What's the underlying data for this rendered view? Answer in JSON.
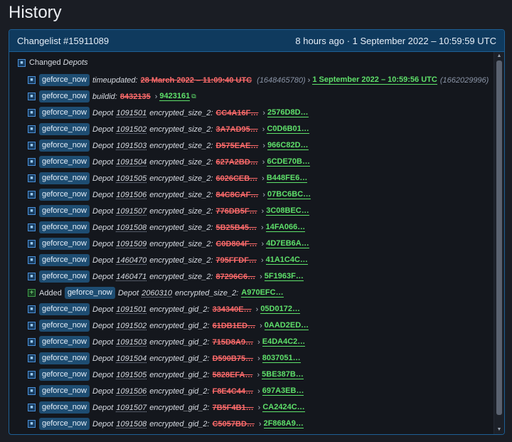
{
  "page": {
    "title": "History"
  },
  "changelist": {
    "title": "Changelist #15911089",
    "meta": "8 hours ago · 1 September 2022 – 10:59:59 UTC"
  },
  "section": {
    "label": "Changed",
    "label_italic": "Depots"
  },
  "app_tag": "geforce_now",
  "rows": [
    {
      "kind": "changed",
      "pre": "timeupdated:",
      "depot": "",
      "key": "",
      "old": "28 March 2022 – 11:09:40 UTC",
      "old_extra": "(1648465780)",
      "new": "1 September 2022 – 10:59:56 UTC",
      "new_extra": "(1662029996)"
    },
    {
      "kind": "changed",
      "pre": "buildid:",
      "depot": "",
      "key": "",
      "old": "8432135",
      "old_extra": "",
      "new": "9423161",
      "new_extra": ""
    },
    {
      "kind": "changed",
      "pre": "Depot",
      "depot": "1091501",
      "key": "encrypted_size_2:",
      "old": "CC4A16F…",
      "new": "2576D8D…"
    },
    {
      "kind": "changed",
      "pre": "Depot",
      "depot": "1091502",
      "key": "encrypted_size_2:",
      "old": "3A7AD95…",
      "new": "C0D6B01…"
    },
    {
      "kind": "changed",
      "pre": "Depot",
      "depot": "1091503",
      "key": "encrypted_size_2:",
      "old": "D575EAE…",
      "new": "966C82D…"
    },
    {
      "kind": "changed",
      "pre": "Depot",
      "depot": "1091504",
      "key": "encrypted_size_2:",
      "old": "627A2BD…",
      "new": "6CDE70B…"
    },
    {
      "kind": "changed",
      "pre": "Depot",
      "depot": "1091505",
      "key": "encrypted_size_2:",
      "old": "6026CEB…",
      "new": "B448FE6…"
    },
    {
      "kind": "changed",
      "pre": "Depot",
      "depot": "1091506",
      "key": "encrypted_size_2:",
      "old": "84C8CAF…",
      "new": "07BC6BC…"
    },
    {
      "kind": "changed",
      "pre": "Depot",
      "depot": "1091507",
      "key": "encrypted_size_2:",
      "old": "776DB5F…",
      "new": "3C08BEC…"
    },
    {
      "kind": "changed",
      "pre": "Depot",
      "depot": "1091508",
      "key": "encrypted_size_2:",
      "old": "5B25B45…",
      "new": "14FA066…"
    },
    {
      "kind": "changed",
      "pre": "Depot",
      "depot": "1091509",
      "key": "encrypted_size_2:",
      "old": "C0D804F…",
      "new": "4D7EB6A…"
    },
    {
      "kind": "changed",
      "pre": "Depot",
      "depot": "1460470",
      "key": "encrypted_size_2:",
      "old": "795FFDF…",
      "new": "41A1C4C…"
    },
    {
      "kind": "changed",
      "pre": "Depot",
      "depot": "1460471",
      "key": "encrypted_size_2:",
      "old": "87296C6…",
      "new": "5F1963F…"
    },
    {
      "kind": "added",
      "label": "Added",
      "pre": "Depot",
      "depot": "2060310",
      "key": "encrypted_size_2:",
      "new": "A970EFC…"
    },
    {
      "kind": "changed",
      "pre": "Depot",
      "depot": "1091501",
      "key": "encrypted_gid_2:",
      "old": "334340E…",
      "new": "05D0172…"
    },
    {
      "kind": "changed",
      "pre": "Depot",
      "depot": "1091502",
      "key": "encrypted_gid_2:",
      "old": "61DB1ED…",
      "new": "0AAD2ED…"
    },
    {
      "kind": "changed",
      "pre": "Depot",
      "depot": "1091503",
      "key": "encrypted_gid_2:",
      "old": "715D8A9…",
      "new": "E4DA4C2…"
    },
    {
      "kind": "changed",
      "pre": "Depot",
      "depot": "1091504",
      "key": "encrypted_gid_2:",
      "old": "D590B75…",
      "new": "8037051…"
    },
    {
      "kind": "changed",
      "pre": "Depot",
      "depot": "1091505",
      "key": "encrypted_gid_2:",
      "old": "5828EFA…",
      "new": "5BE387B…"
    },
    {
      "kind": "changed",
      "pre": "Depot",
      "depot": "1091506",
      "key": "encrypted_gid_2:",
      "old": "F8E4C44…",
      "new": "697A3EB…"
    },
    {
      "kind": "changed",
      "pre": "Depot",
      "depot": "1091507",
      "key": "encrypted_gid_2:",
      "old": "7B5F4B1…",
      "new": "CA2424C…"
    },
    {
      "kind": "changed",
      "pre": "Depot",
      "depot": "1091508",
      "key": "encrypted_gid_2:",
      "old": "C5057BD…",
      "new": "2F868A9…"
    }
  ],
  "colors": {
    "panel_header": "#0f3a5e",
    "old_value": "#ff6b6b",
    "new_value": "#5ee06a",
    "app_tag": "#1e4d72"
  },
  "icons": {
    "changed": "square-bullet-icon",
    "added": "plus-square-icon",
    "link": "external-link-icon"
  }
}
